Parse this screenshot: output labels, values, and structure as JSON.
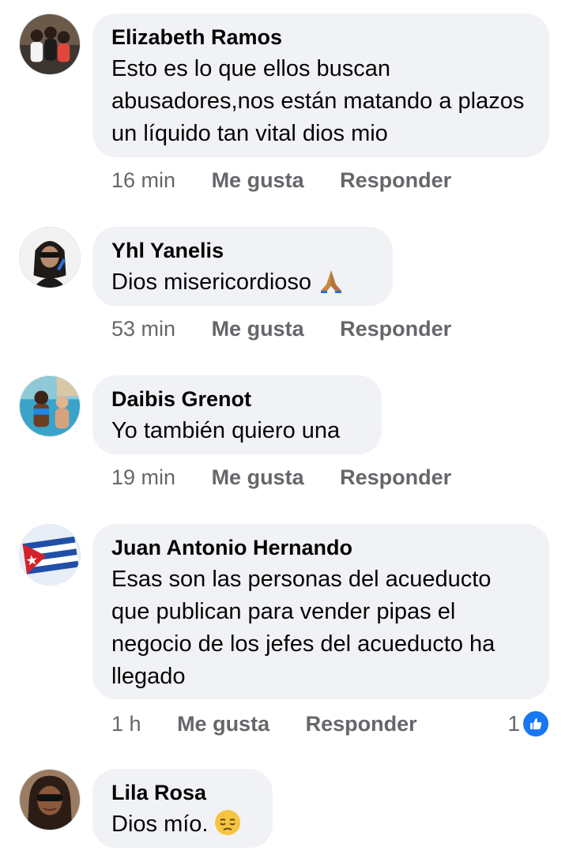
{
  "comments": [
    {
      "author": "Elizabeth Ramos",
      "text": "Esto es lo que ellos buscan abusadores,nos están matando a plazos un líquido tan vital dios mio",
      "time": "16 min",
      "like_label": "Me gusta",
      "reply_label": "Responder",
      "avatar_icon": "profile-photo-three-women"
    },
    {
      "author": "Yhl Yanelis",
      "text": "Dios misericordioso",
      "emoji": "folded-hands-icon",
      "time": "53 min",
      "like_label": "Me gusta",
      "reply_label": "Responder",
      "avatar_icon": "profile-photo-woman-sunglasses"
    },
    {
      "author": "Daibis Grenot",
      "text": "Yo también quiero una",
      "time": "19 min",
      "like_label": "Me gusta",
      "reply_label": "Responder",
      "avatar_icon": "profile-photo-pool"
    },
    {
      "author": "Juan Antonio Hernando",
      "text": "Esas son las personas del acueducto que publican para vender pipas el negocio de los jefes del acueducto ha llegado",
      "time": "1 h",
      "like_label": "Me gusta",
      "reply_label": "Responder",
      "reaction_count": "1",
      "avatar_icon": "cuban-flag-icon"
    },
    {
      "author": "Lila Rosa",
      "text": "Dios mío.",
      "emoji": "pensive-face-icon",
      "avatar_icon": "profile-photo-woman-glasses"
    }
  ],
  "colors": {
    "bubble": "#f0f2f5",
    "meta": "#65676b",
    "like_blue": "#1877f2"
  }
}
